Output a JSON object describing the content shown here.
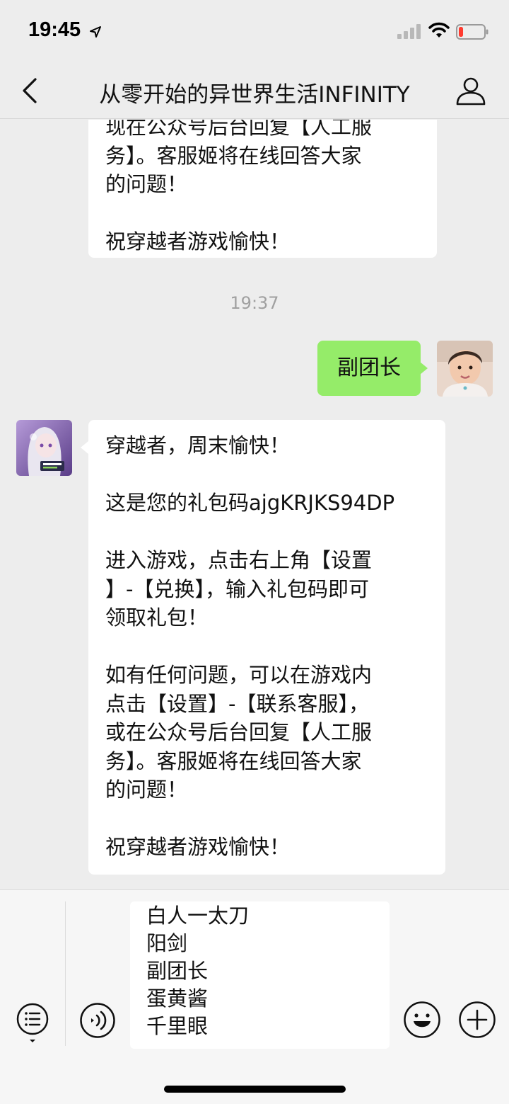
{
  "status_bar": {
    "time": "19:45",
    "icons": [
      "location-arrow-icon",
      "signal-icon",
      "wifi-icon",
      "battery-low-icon"
    ]
  },
  "nav": {
    "title": "从零开始的异世界生活INFINITY",
    "back_icon": "chevron-left-icon",
    "profile_icon": "person-icon"
  },
  "messages": {
    "top_partial": "现在公众号后台回复【人工服务】。客服姬将在线回答大家的问题！\n\n祝穿越者游戏愉快！",
    "top_partial_lines": "现在公众号后台回复【人工服\n务】。客服姬将在线回答大家\n的问题！\n\n祝穿越者游戏愉快！",
    "timestamp": "19:37",
    "sent": "副团长",
    "received": "穿越者，周末愉快！\n\n这是您的礼包码ajgKRJKS94DP\n\n进入游戏，点击右上角【设置\n】-【兑换】，输入礼包码即可\n领取礼包！\n\n如有任何问题，可以在游戏内\n点击【设置】-【联系客服】，\n或在公众号后台回复【人工服\n务】。客服姬将在线回答大家\n的问题！\n\n祝穿越者游戏愉快！"
  },
  "input": {
    "text": "白人一太刀\n阳剑\n副团长\n蛋黄酱\n千里眼",
    "icons": [
      "list-menu-icon",
      "voice-icon",
      "emoji-icon",
      "plus-icon"
    ]
  },
  "colors": {
    "background": "#ededed",
    "sent_bubble": "#95ec69",
    "received_bubble": "#ffffff"
  }
}
